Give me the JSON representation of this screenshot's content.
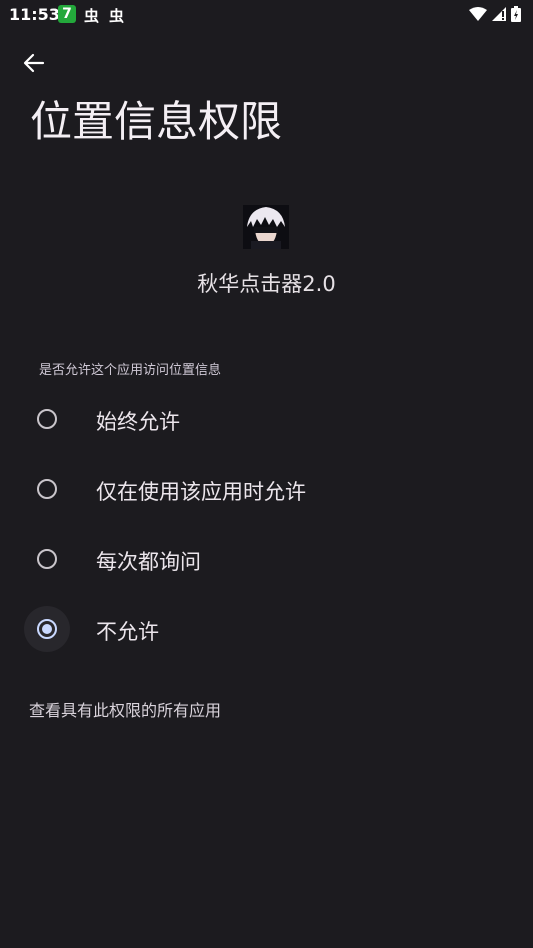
{
  "status_bar": {
    "time": "11:53",
    "app_badge": "7",
    "notification_icons": [
      "虫",
      "虫"
    ]
  },
  "header": {
    "title": "位置信息权限"
  },
  "app": {
    "name": "秋华点击器2.0"
  },
  "permission": {
    "question": "是否允许这个应用访问位置信息",
    "options": [
      {
        "label": "始终允许",
        "selected": false
      },
      {
        "label": "仅在使用该应用时允许",
        "selected": false
      },
      {
        "label": "每次都询问",
        "selected": false
      },
      {
        "label": "不允许",
        "selected": true
      }
    ]
  },
  "footer": {
    "all_apps_link": "查看具有此权限的所有应用"
  },
  "colors": {
    "background": "#1c1b1f",
    "accent": "#c9d8ff",
    "badge": "#23a83b"
  }
}
